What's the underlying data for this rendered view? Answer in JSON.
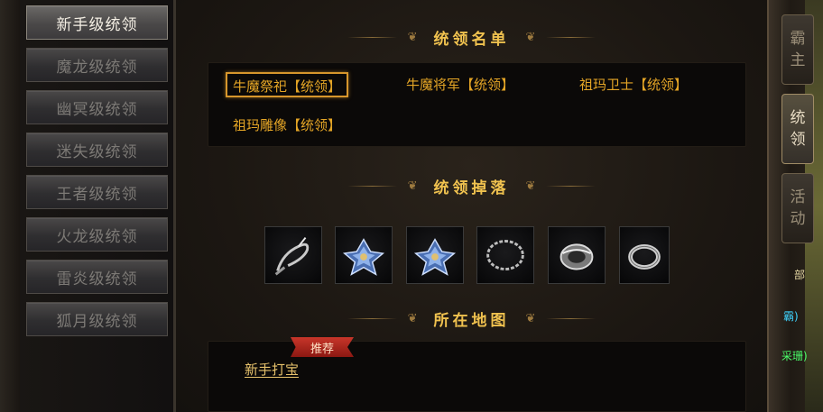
{
  "categories": [
    {
      "label": "新手级统领",
      "active": true
    },
    {
      "label": "魔龙级统领",
      "active": false
    },
    {
      "label": "幽冥级统领",
      "active": false
    },
    {
      "label": "迷失级统领",
      "active": false
    },
    {
      "label": "王者级统领",
      "active": false
    },
    {
      "label": "火龙级统领",
      "active": false
    },
    {
      "label": "雷炎级统领",
      "active": false
    },
    {
      "label": "狐月级统领",
      "active": false
    }
  ],
  "sections": {
    "roster_title": "统领名单",
    "drops_title": "统领掉落",
    "map_title": "所在地图"
  },
  "leaders": [
    {
      "label": "牛魔祭祀【统领】",
      "selected": true
    },
    {
      "label": "牛魔将军【统领】",
      "selected": false
    },
    {
      "label": "祖玛卫士【统领】",
      "selected": false
    },
    {
      "label": "祖玛雕像【统领】",
      "selected": false
    }
  ],
  "drops": [
    {
      "icon": "whip-icon"
    },
    {
      "icon": "crystal-flower-icon"
    },
    {
      "icon": "crystal-flower-icon"
    },
    {
      "icon": "chain-necklace-icon"
    },
    {
      "icon": "bracelet-icon"
    },
    {
      "icon": "ring-icon"
    }
  ],
  "map": {
    "badge": "推荐",
    "link": "新手打宝"
  },
  "side_tabs": [
    {
      "label_top": "霸",
      "label_bottom": "主",
      "active": false
    },
    {
      "label_top": "统",
      "label_bottom": "领",
      "active": true
    },
    {
      "label_top": "活",
      "label_bottom": "动",
      "active": false
    }
  ],
  "edge_fragments": [
    "部",
    "霸)",
    "采珊)"
  ],
  "colors": {
    "accent_gold": "#f0c24f",
    "leader_text": "#e4a526",
    "badge_red": "#c8362a"
  }
}
